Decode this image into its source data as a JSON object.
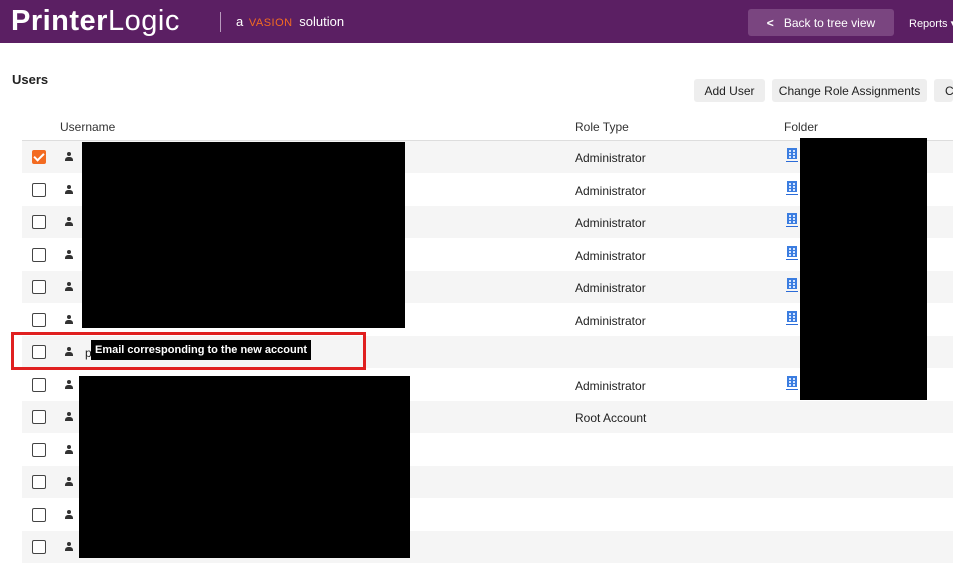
{
  "header": {
    "logo_bold": "Printer",
    "logo_light": "Logic",
    "tagline_prefix": "a",
    "tagline_brand": "VASION",
    "tagline_suffix": "solution",
    "back_label": "Back to tree view",
    "reports_label": "Reports ▾"
  },
  "page": {
    "title": "Users"
  },
  "actions": {
    "add_user": "Add User",
    "change_roles": "Change Role Assignments",
    "truncated": "C"
  },
  "table": {
    "columns": [
      "Username",
      "Role Type",
      "Folder"
    ],
    "rows": [
      {
        "checked": true,
        "role": "Administrator",
        "has_folder": true
      },
      {
        "checked": false,
        "role": "Administrator",
        "has_folder": true
      },
      {
        "checked": false,
        "role": "Administrator",
        "has_folder": true
      },
      {
        "checked": false,
        "role": "Administrator",
        "has_folder": true
      },
      {
        "checked": false,
        "role": "Administrator",
        "has_folder": true
      },
      {
        "checked": false,
        "role": "Administrator",
        "has_folder": true
      },
      {
        "checked": false,
        "role": "",
        "has_folder": false,
        "username_fragment": "p"
      },
      {
        "checked": false,
        "role": "Administrator",
        "has_folder": true
      },
      {
        "checked": false,
        "role": "Root Account",
        "has_folder": false
      },
      {
        "checked": false,
        "role": "",
        "has_folder": false
      },
      {
        "checked": false,
        "role": "",
        "has_folder": false
      },
      {
        "checked": false,
        "role": "",
        "has_folder": false
      },
      {
        "checked": false,
        "role": "",
        "has_folder": false
      }
    ]
  },
  "annotation": {
    "text": "Email corresponding to the new account",
    "color": "#e02020"
  },
  "colors": {
    "header_bg": "#5b1f63",
    "accent": "#f36b21",
    "folder_icon": "#3b7de0"
  }
}
